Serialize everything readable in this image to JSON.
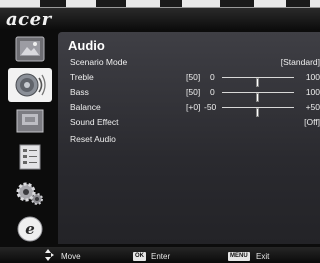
{
  "brand": {
    "logo": "acer"
  },
  "sidebar": {
    "items": [
      {
        "icon": "picture-icon"
      },
      {
        "icon": "audio-speaker-icon"
      },
      {
        "icon": "display-setting-icon"
      },
      {
        "icon": "checklist-icon"
      },
      {
        "icon": "gear-settings-icon"
      },
      {
        "icon": "acer-empowering-icon"
      }
    ]
  },
  "menu": {
    "title": "Audio",
    "scenario_mode": {
      "label": "Scenario Mode",
      "value": "[Standard]"
    },
    "treble": {
      "label": "Treble",
      "value_text": "[50]",
      "min": "0",
      "max": "100",
      "level": 50
    },
    "bass": {
      "label": "Bass",
      "value_text": "[50]",
      "min": "0",
      "max": "100",
      "level": 50
    },
    "balance": {
      "label": "Balance",
      "value_text": "[+0]",
      "min": "-50",
      "max": "+50",
      "level": 0
    },
    "sound_effect": {
      "label": "Sound Effect",
      "value": "[Off]"
    },
    "reset_audio": {
      "label": "Reset Audio"
    }
  },
  "footer": {
    "move_label": "Move",
    "ok_key": "OK",
    "enter_label": "Enter",
    "menu_key": "MENU",
    "exit_label": "Exit"
  }
}
